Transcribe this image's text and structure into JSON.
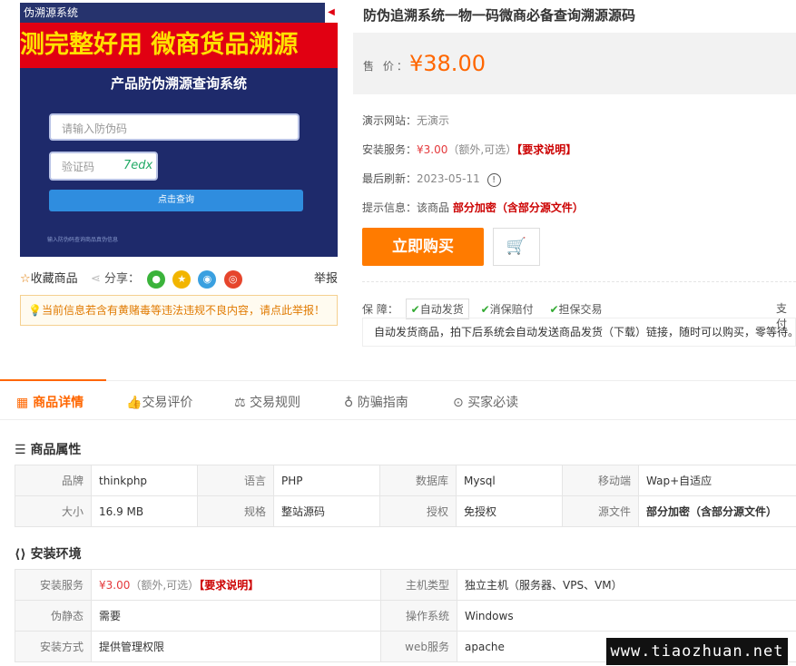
{
  "product_image": {
    "top_label": "伪溯源系统",
    "banner_text": "测完整好用  微商货品溯源",
    "title": "产品防伪溯源查询系统",
    "input_placeholder": "请输入防伪码",
    "captcha_placeholder": "验证码",
    "captcha_value": "7edx",
    "query_button": "点击查询",
    "footnote": "输入防伪码查询商品真伪信息",
    "nav_arrow": "◀"
  },
  "actions": {
    "favorite": "收藏商品",
    "share_label": "分享：",
    "report": "举报"
  },
  "notice": "当前信息若含有黄赌毒等违法违规不良内容，请点此举报！",
  "product": {
    "title": "防伪追溯系统一物一码微商必备查询溯源源码",
    "price_label": "售 价：",
    "price": "¥38.00"
  },
  "info_rows": [
    {
      "label": "演示网站：",
      "value": "无演示"
    },
    {
      "label": "安装服务：",
      "price": "¥3.00",
      "extra": "（额外,可选）",
      "link": "【要求说明】"
    },
    {
      "label": "最后刷新：",
      "value": "2023-05-11"
    },
    {
      "label": "提示信息：",
      "prefix": "该商品",
      "highlight": "部分加密（含部分源文件）"
    }
  ],
  "buttons": {
    "buy_now": "立即购买"
  },
  "guarantee": {
    "label": "保  障：",
    "tags": [
      "自动发货",
      "消保赔付",
      "担保交易"
    ],
    "pay": "支付",
    "auto_ship_text": "自动发货商品，拍下后系统会自动发送商品发货（下载）链接，随时可以购买，零等待。"
  },
  "tabs": [
    "商品详情",
    "交易评价",
    "交易规则",
    "防骗指南",
    "买家必读"
  ],
  "attributes": {
    "title": "商品属性",
    "rows": [
      [
        {
          "k": "品牌",
          "v": "thinkphp"
        },
        {
          "k": "语言",
          "v": "PHP"
        },
        {
          "k": "数据库",
          "v": "Mysql"
        },
        {
          "k": "移动端",
          "v": "Wap+自适应"
        }
      ],
      [
        {
          "k": "大小",
          "v": "16.9 MB"
        },
        {
          "k": "规格",
          "v": "整站源码"
        },
        {
          "k": "授权",
          "v": "免授权"
        },
        {
          "k": "源文件",
          "v": "部分加密（含部分源文件）"
        }
      ]
    ]
  },
  "environment": {
    "title": "安装环境",
    "rows": [
      [
        {
          "k": "安装服务",
          "price": "¥3.00",
          "extra": "（额外,可选）",
          "link": "【要求说明】"
        },
        {
          "k": "主机类型",
          "v": "独立主机（服务器、VPS、VM）"
        }
      ],
      [
        {
          "k": "伪静态",
          "v": "需要"
        },
        {
          "k": "操作系统",
          "v": "Windows"
        }
      ],
      [
        {
          "k": "安装方式",
          "v": "提供管理权限"
        },
        {
          "k": "web服务",
          "v": "apache"
        }
      ]
    ]
  },
  "watermark": "www.tiaozhuan.net",
  "colors": {
    "accent": "#ff6600",
    "buy_button": "#ff7b00",
    "red": "#e4393c"
  }
}
